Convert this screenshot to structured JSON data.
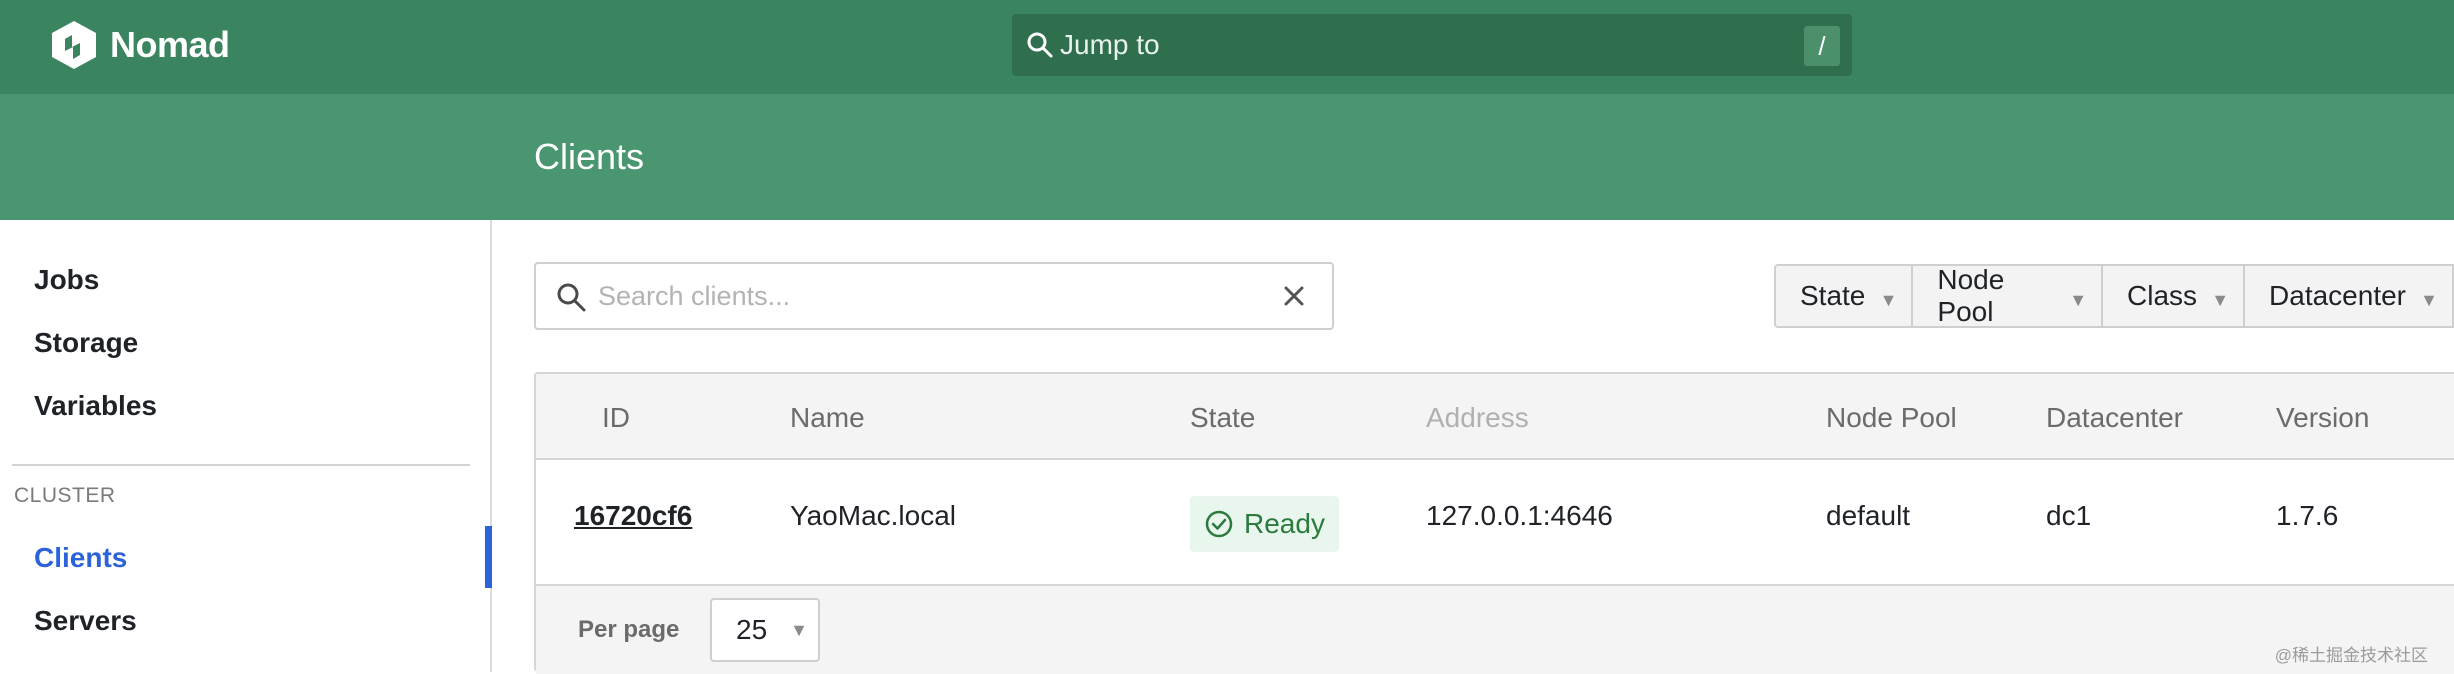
{
  "app": {
    "name": "Nomad"
  },
  "search_bar": {
    "placeholder": "Jump to",
    "shortcut": "/"
  },
  "page": {
    "title": "Clients"
  },
  "sidebar": {
    "items": [
      {
        "label": "Jobs"
      },
      {
        "label": "Storage"
      },
      {
        "label": "Variables"
      }
    ],
    "section_label": "CLUSTER",
    "cluster_items": [
      {
        "label": "Clients",
        "active": true
      },
      {
        "label": "Servers",
        "active": false
      }
    ]
  },
  "client_search": {
    "placeholder": "Search clients..."
  },
  "filters": [
    {
      "label": "State"
    },
    {
      "label": "Node Pool"
    },
    {
      "label": "Class"
    },
    {
      "label": "Datacenter"
    }
  ],
  "table": {
    "headers": [
      "ID",
      "Name",
      "State",
      "Address",
      "Node Pool",
      "Datacenter",
      "Version"
    ],
    "rows": [
      {
        "id": "16720cf6",
        "name": "YaoMac.local",
        "state": "Ready",
        "address": "127.0.0.1:4646",
        "node_pool": "default",
        "datacenter": "dc1",
        "version": "1.7.6"
      }
    ],
    "per_page_label": "Per page",
    "per_page_value": "25"
  },
  "watermark": "@稀土掘金技术社区",
  "colors": {
    "topbar": "#3a855f",
    "subheader": "#4a9670",
    "accent": "#2d63d8",
    "ready_text": "#2b7a3e",
    "ready_bg": "#e9f6ee"
  },
  "icons": [
    "nomad-logo-icon",
    "search-icon",
    "close-icon",
    "check-circle-icon",
    "chevron-down-icon"
  ]
}
